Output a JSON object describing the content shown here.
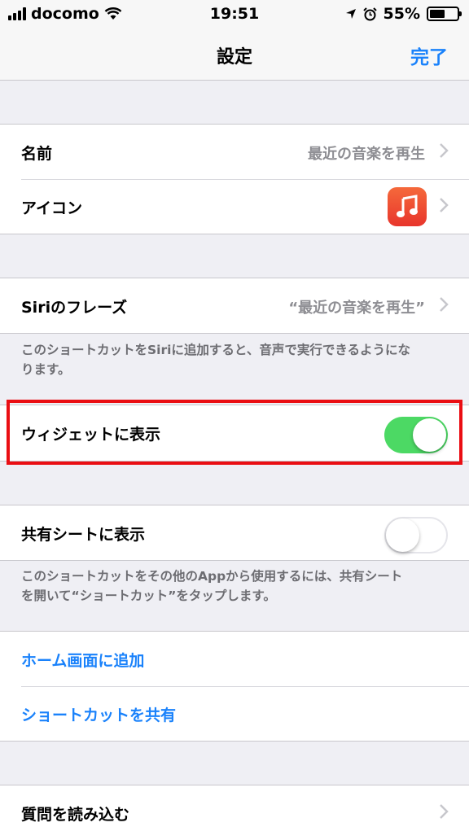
{
  "status_bar": {
    "carrier": "docomo",
    "time": "19:51",
    "battery": "55%",
    "battery_level": 0.55
  },
  "nav": {
    "title": "設定",
    "done": "完了"
  },
  "section1": {
    "name_label": "名前",
    "name_value": "最近の音楽を再生",
    "icon_label": "アイコン"
  },
  "section2": {
    "siri_label": "Siriのフレーズ",
    "siri_value": "“最近の音楽を再生”",
    "note_line1": "このショートカットをSiriに追加すると、音声で実行できるようにな",
    "note_line2": "ります。"
  },
  "widget": {
    "label": "ウィジェットに表示",
    "on": true
  },
  "share_sheet": {
    "label": "共有シートに表示",
    "on": false,
    "note_line1": "このショートカットをその他のAppから使用するには、共有シート",
    "note_line2": "を開いて“ショートカット”をタップします。"
  },
  "actions": {
    "add_home": "ホーム画面に追加",
    "share_shortcut": "ショートカットを共有"
  },
  "last": {
    "import_questions": "質問を読み込む"
  },
  "colors": {
    "accent": "#1a82fb",
    "toggle_on": "#4cd964",
    "highlight": "#ea0e13"
  }
}
